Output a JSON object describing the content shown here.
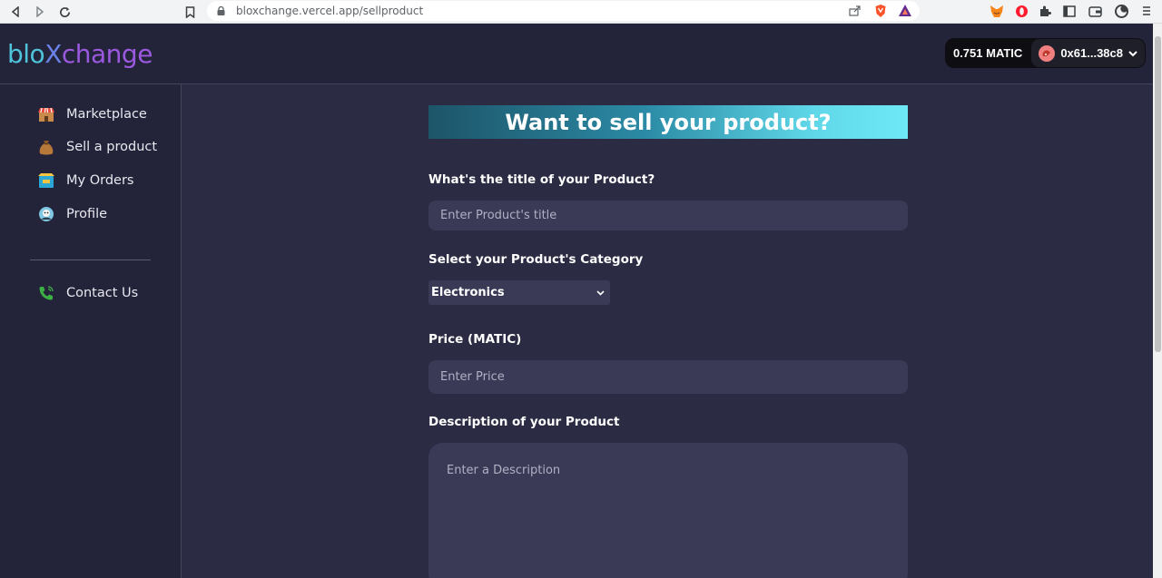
{
  "browser": {
    "url": "bloxchange.vercel.app/sellproduct",
    "icons": [
      "back-icon",
      "forward-icon",
      "reload-icon",
      "bookmark-icon",
      "lock-icon",
      "share-icon",
      "brave-shield-icon",
      "brave-rewards-icon",
      "metamask-icon",
      "opera-icon",
      "extensions-icon",
      "sidebar-icon",
      "wallet-icon",
      "profile-icon",
      "menu-icon"
    ]
  },
  "header": {
    "logo_part1": "blo",
    "logo_part2": "X",
    "logo_part3": "change",
    "balance": "0.751 MATIC",
    "account": "0x61...38c8"
  },
  "sidebar": {
    "items": [
      {
        "label": "Marketplace",
        "icon": "marketplace-icon"
      },
      {
        "label": "Sell a product",
        "icon": "money-bag-icon"
      },
      {
        "label": "My Orders",
        "icon": "orders-icon"
      },
      {
        "label": "Profile",
        "icon": "profile-icon"
      }
    ],
    "contact": {
      "label": "Contact Us",
      "icon": "phone-icon"
    }
  },
  "form": {
    "heading": "Want to sell your product?",
    "title_label": "What's the title of your Product?",
    "title_placeholder": "Enter Product's title",
    "category_label": "Select your Product's Category",
    "category_selected": "Electronics",
    "price_label": "Price (MATIC)",
    "price_placeholder": "Enter Price",
    "description_label": "Description of your Product",
    "description_placeholder": "Enter a Description"
  },
  "colors": {
    "page_bg": "#2b2b43",
    "panel_bg": "#232339",
    "input_bg": "#3a3a56",
    "banner_start": "#1d5468",
    "banner_end": "#6ee8f6",
    "logo_teal": "#4fc3d9",
    "logo_purple": "#9b59e0"
  }
}
